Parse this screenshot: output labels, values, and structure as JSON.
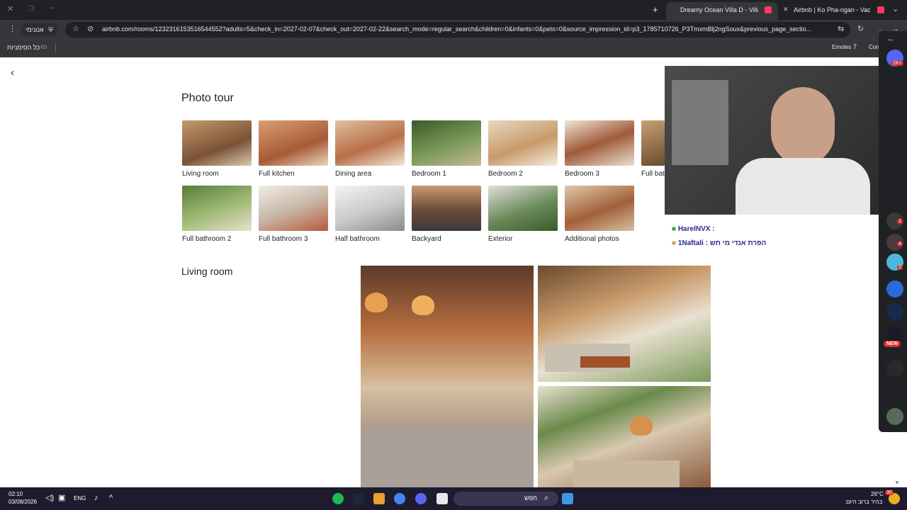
{
  "browser": {
    "tabs": [
      {
        "title": "Airbnb | Ko Pha-ngan - Vacation"
      },
      {
        "title": "Dreamy Ocean Villa D - Villas fo"
      }
    ],
    "new_tab_label": "+",
    "incognito_label": "אנונימי",
    "url": "airbnb.com/rooms/1232316153516544552?adults=5&check_in=2027-02-07&check_out=2027-02-22&search_mode=regular_search&children=0&infants=0&pets=0&source_impression_id=p3_1785710726_P3TmxmBlj2ngSoux&previous_page_sectio...",
    "bookmarks_label": "כל הסימניות",
    "extension_emotes": "Emotes",
    "extension_con": "Con"
  },
  "page": {
    "title": "Photo tour",
    "section_title": "Living room",
    "thumbnails_row1": [
      {
        "label": "Living room",
        "color": "#a07048"
      },
      {
        "label": "Full kitchen",
        "color": "#b9764a"
      },
      {
        "label": "Dining area",
        "color": "#c89a6e"
      },
      {
        "label": "Bedroom 1",
        "color": "#5e7a4a"
      },
      {
        "label": "Bedroom 2",
        "color": "#d8c0a0"
      },
      {
        "label": "Bedroom 3",
        "color": "#d9cdb6"
      },
      {
        "label": "Full bath",
        "color": "#8a6a4a"
      }
    ],
    "thumbnails_row2": [
      {
        "label": "Full bathroom 2",
        "color": "#7c9a5c"
      },
      {
        "label": "Full bathroom 3",
        "color": "#c8b8a8"
      },
      {
        "label": "Half bathroom",
        "color": "#e0e0e0"
      },
      {
        "label": "Backyard",
        "color": "#7a5a48"
      },
      {
        "label": "Exterior",
        "color": "#6a8a5a"
      },
      {
        "label": "Additional photos",
        "color": "#a0704a"
      }
    ]
  },
  "stream": {
    "chat": [
      {
        "user": "HarelNVX",
        "text": ":"
      },
      {
        "user": "1Naftali",
        "text": ": הפרת אנדי מי חש"
      }
    ],
    "side_badges": [
      "1K+",
      "1",
      "4",
      "2",
      "NEW"
    ]
  },
  "taskbar": {
    "time": "02:10",
    "date": "03/08/2026",
    "language": "ENG",
    "search_placeholder": "חפש",
    "weather_temp": "26°C",
    "weather_desc": "בהיר ברוב היום",
    "notification_count": "35"
  },
  "colors": {
    "chrome_dark": "#202124",
    "chrome_mid": "#35363a",
    "airbnb": "#ff385c",
    "taskbar": "#1f1b2e"
  }
}
